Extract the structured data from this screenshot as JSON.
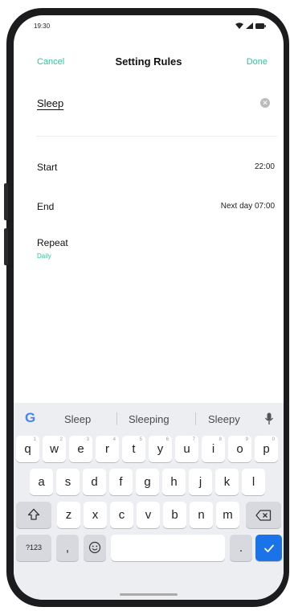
{
  "status_bar": {
    "time": "19:30"
  },
  "nav": {
    "cancel": "Cancel",
    "title": "Setting Rules",
    "done": "Done"
  },
  "rule_name": {
    "value": "Sleep"
  },
  "rows": {
    "start": {
      "label": "Start",
      "value": "22:00"
    },
    "end": {
      "label": "End",
      "value": "Next day 07:00"
    },
    "repeat": {
      "label": "Repeat",
      "value": "Daily"
    }
  },
  "keyboard": {
    "suggestions": [
      "Sleep",
      "Sleeping",
      "Sleepy"
    ],
    "row1": [
      {
        "k": "q",
        "h": "1"
      },
      {
        "k": "w",
        "h": "2"
      },
      {
        "k": "e",
        "h": "3"
      },
      {
        "k": "r",
        "h": "4"
      },
      {
        "k": "t",
        "h": "5"
      },
      {
        "k": "y",
        "h": "6"
      },
      {
        "k": "u",
        "h": "7"
      },
      {
        "k": "i",
        "h": "8"
      },
      {
        "k": "o",
        "h": "9"
      },
      {
        "k": "p",
        "h": "0"
      }
    ],
    "row2": [
      "a",
      "s",
      "d",
      "f",
      "g",
      "h",
      "j",
      "k",
      "l"
    ],
    "row3": [
      "z",
      "x",
      "c",
      "v",
      "b",
      "n",
      "m"
    ],
    "symbols_key": "?123",
    "comma_key": ",",
    "period_key": "."
  },
  "colors": {
    "accent": "#2fc59a",
    "enter_key": "#1a73e8",
    "bezel": "#1c1c1e",
    "keyboard_bg": "#eceef1"
  },
  "icons": [
    "wifi-icon",
    "signal-icon",
    "battery-icon",
    "clear-icon",
    "google-icon",
    "mic-icon",
    "shift-icon",
    "backspace-icon",
    "emoji-icon",
    "check-icon"
  ]
}
